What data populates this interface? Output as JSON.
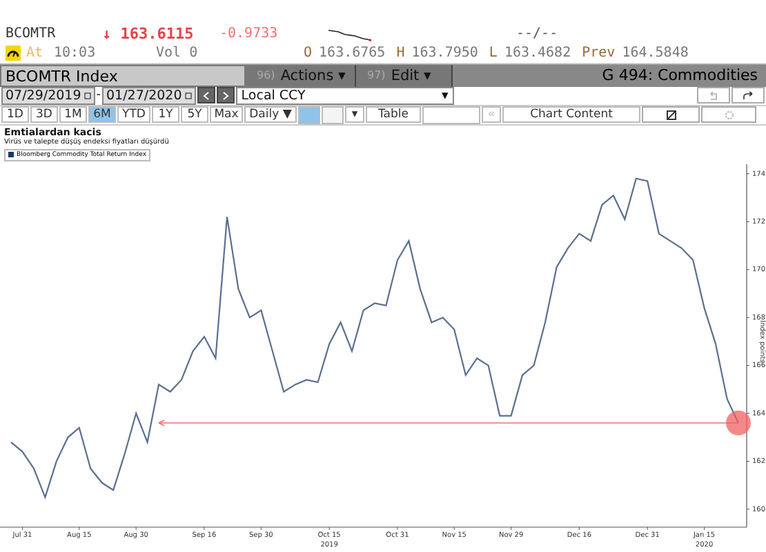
{
  "quote": {
    "ticker": "BCOMTR",
    "arrow": "↓",
    "last": "163.6115",
    "change": "-0.9733",
    "range": "--/--",
    "at_label": "At",
    "time": "10:03",
    "volume": "Vol 0",
    "stats": [
      {
        "label": "O",
        "value": "163.6765"
      },
      {
        "label": "H",
        "value": "163.7950"
      },
      {
        "label": "L",
        "value": "163.4682"
      },
      {
        "label": "Prev",
        "value": "164.5848"
      }
    ]
  },
  "toolbar": {
    "security": "BCOMTR Index",
    "actions": [
      {
        "number": "96)",
        "label": "Actions ▾"
      },
      {
        "number": "97)",
        "label": "Edit ▾"
      }
    ],
    "page": "G 494: Commodities",
    "start_date": "07/29/2019",
    "separator": "-",
    "end_date": "01/27/2020",
    "currency": "Local CCY",
    "dropdown": "▾"
  },
  "periods": [
    {
      "label": "1D",
      "selected": false
    },
    {
      "label": "3D",
      "selected": false
    },
    {
      "label": "1M",
      "selected": false
    },
    {
      "label": "6M",
      "selected": true
    },
    {
      "label": "YTD",
      "selected": false
    },
    {
      "label": "1Y",
      "selected": false
    },
    {
      "label": "5Y",
      "selected": false
    },
    {
      "label": "Max",
      "selected": false
    }
  ],
  "frequency": "Daily ▼",
  "type_dropdown": "▾",
  "table_button": "Table",
  "collapse": "«",
  "chart_content": "Chart Content",
  "chart": {
    "title": "Emtialardan kacis",
    "subtitle": "Virüs ve talepte düşüş endeksi fiyatları düşürdü",
    "year_labels": [
      "2019",
      "2020"
    ],
    "markers": [
      {
        "kind": "circle"
      }
    ],
    "chart_data": {
      "type": "line",
      "ylabel": "Index points",
      "ylim": [
        159.25,
        174.4
      ],
      "ref_lines": [
        {
          "axis": "y",
          "value": 163.6,
          "color": "#f07070"
        }
      ],
      "categories": [
        null,
        "Jul 31",
        null,
        null,
        null,
        null,
        "Aug 15",
        null,
        null,
        null,
        null,
        "Aug 30",
        null,
        null,
        null,
        null,
        null,
        "Sep 16",
        null,
        null,
        null,
        null,
        "Sep 30",
        null,
        null,
        null,
        null,
        null,
        "Oct 15",
        null,
        null,
        null,
        null,
        null,
        "Oct 31",
        null,
        null,
        null,
        null,
        "Nov 15",
        null,
        null,
        null,
        null,
        "Nov 29",
        null,
        null,
        null,
        null,
        null,
        "Dec 16",
        null,
        null,
        null,
        null,
        null,
        "Dec 31",
        null,
        null,
        null,
        null,
        "Jan 15",
        null,
        null,
        null
      ],
      "series": [
        {
          "name": "Bloomberg Commodity Total Return Index",
          "color": "#5a6f8f",
          "values": [
            162.8,
            162.4,
            161.7,
            160.5,
            162.0,
            163.0,
            163.4,
            161.7,
            161.1,
            160.8,
            162.3,
            164.0,
            162.8,
            165.2,
            164.9,
            165.4,
            166.6,
            167.2,
            166.3,
            172.2,
            169.2,
            168.0,
            168.3,
            166.6,
            164.9,
            165.2,
            165.4,
            165.3,
            166.9,
            167.8,
            166.6,
            168.3,
            168.6,
            168.5,
            170.4,
            171.2,
            169.2,
            167.8,
            168.0,
            167.5,
            165.6,
            166.3,
            166.0,
            163.9,
            163.9,
            165.6,
            166.0,
            167.8,
            170.1,
            170.9,
            171.5,
            171.2,
            172.7,
            173.1,
            172.1,
            173.8,
            173.7,
            171.5,
            171.2,
            170.9,
            170.4,
            168.4,
            166.9,
            164.6,
            163.6
          ]
        }
      ],
      "yticks": [
        160,
        162,
        164,
        166,
        168,
        170,
        172,
        174
      ]
    }
  }
}
